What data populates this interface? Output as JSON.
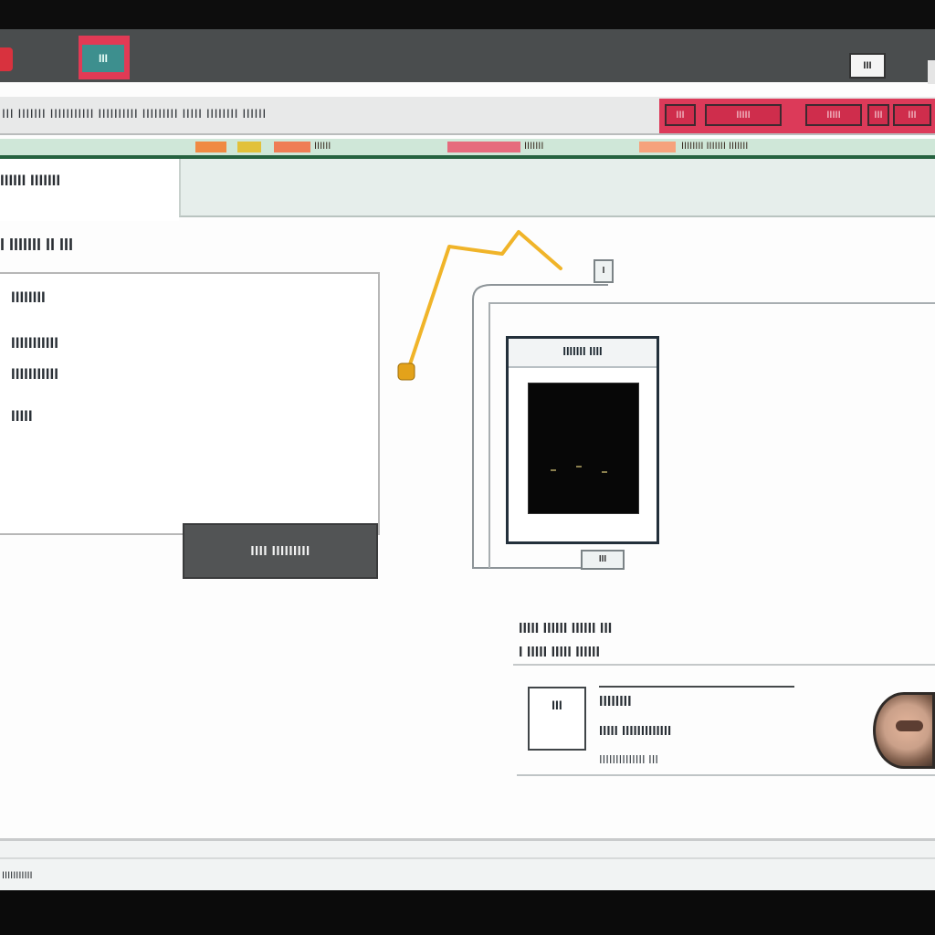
{
  "window": {
    "tab_label": "III",
    "control_label": "III"
  },
  "toolbar": {
    "text": "III IIIIIII IIIIIIIIIII IIIIIIIIII IIIIIIIII IIIII IIIIIIII IIIIII",
    "accent_items": [
      "III",
      "IIIII",
      "IIIII",
      "III",
      "III"
    ]
  },
  "strip": {
    "labels": [
      "IIIIII",
      "IIIIIII",
      "IIIIIIII IIIIIII IIIIIII"
    ]
  },
  "tabs": {
    "active_label": "IIIIII IIIIIII"
  },
  "main": {
    "section_heading": "I IIIIIII II III",
    "detail_lines": [
      "IIIIIIII",
      "IIIIIIIIIII",
      "IIIIIIIIIII",
      "IIIII"
    ],
    "primary_button": "IIII IIIIIIIII"
  },
  "preview": {
    "card_title": "IIIIIII IIII",
    "top_handle": "I",
    "bottom_handle": "III"
  },
  "info": {
    "heading_line1": "IIIII IIIIII IIIIII III",
    "heading_line2": "I IIIII IIIII IIIIII",
    "card_badge": "III",
    "card_line1": "IIIIIIII",
    "card_line2": "IIIII IIIIIIIIIIIII",
    "card_line3": "IIIIIIIIIIIIII III"
  },
  "status": {
    "text": "IIIIIIIIIII"
  },
  "colors": {
    "titlebar": "#4a4d4e",
    "accent_red": "#dc3a59",
    "accent_teal": "#3d8f8e",
    "connector_yellow": "#f0b429",
    "strip_green": "#25623f"
  }
}
